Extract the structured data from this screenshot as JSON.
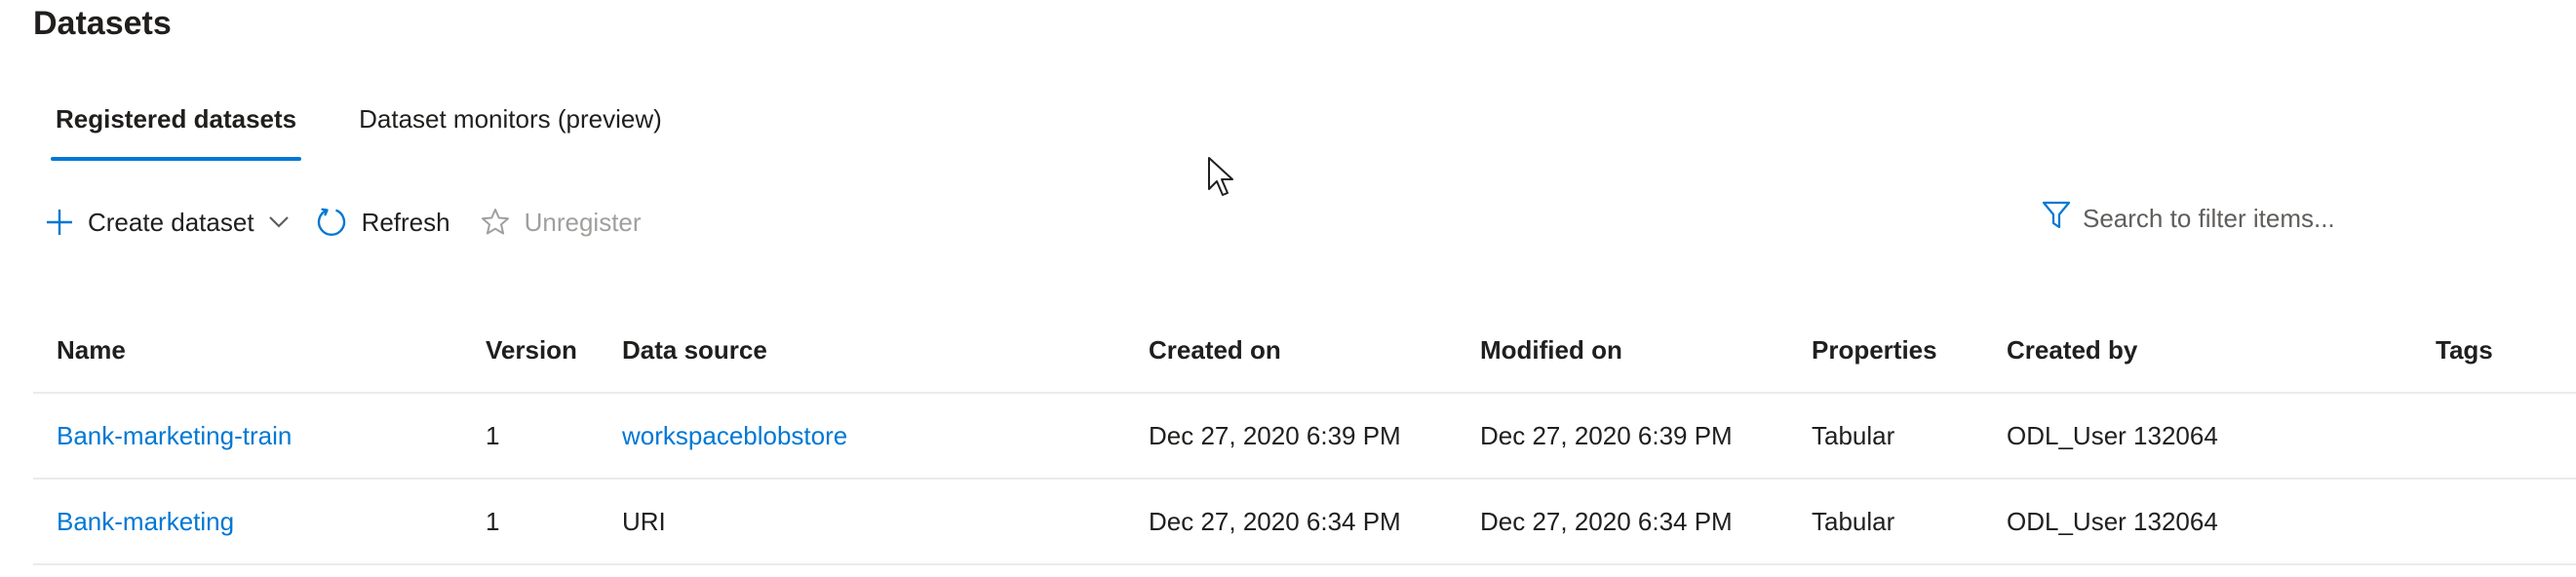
{
  "page": {
    "title": "Datasets"
  },
  "tabs": [
    {
      "label": "Registered datasets",
      "active": true
    },
    {
      "label": "Dataset monitors (preview)",
      "active": false
    }
  ],
  "toolbar": {
    "create_label": "Create dataset",
    "refresh_label": "Refresh",
    "unregister_label": "Unregister"
  },
  "filter": {
    "placeholder": "Search to filter items..."
  },
  "table": {
    "columns": [
      "Name",
      "Version",
      "Data source",
      "Created on",
      "Modified on",
      "Properties",
      "Created by",
      "Tags"
    ],
    "rows": [
      {
        "name": "Bank-marketing-train",
        "version": "1",
        "data_source": "workspaceblobstore",
        "created_on": "Dec 27, 2020 6:39 PM",
        "modified_on": "Dec 27, 2020 6:39 PM",
        "properties": "Tabular",
        "created_by": "ODL_User 132064",
        "tags": ""
      },
      {
        "name": "Bank-marketing",
        "version": "1",
        "data_source": "URI",
        "created_on": "Dec 27, 2020 6:34 PM",
        "modified_on": "Dec 27, 2020 6:34 PM",
        "properties": "Tabular",
        "created_by": "ODL_User 132064",
        "tags": ""
      }
    ]
  },
  "colors": {
    "accent": "#0078d4",
    "text": "#201f1e",
    "disabled": "#a19f9d",
    "divider": "#edebe9"
  }
}
